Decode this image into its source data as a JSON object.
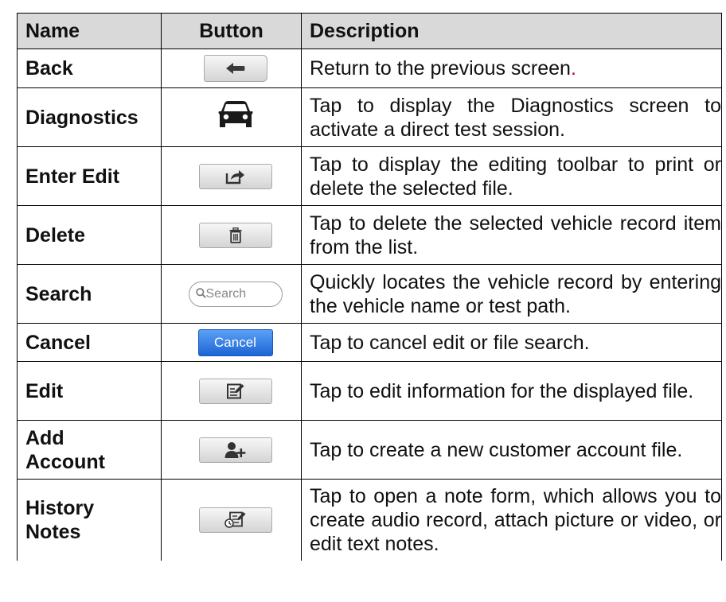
{
  "headers": {
    "name": "Name",
    "button": "Button",
    "description": "Description"
  },
  "rows": [
    {
      "name": "Back",
      "button_icon": "back-arrow-icon",
      "description": "Return to the previous screen",
      "description_end": "."
    },
    {
      "name": "Diagnostics",
      "button_icon": "car-icon",
      "description": "Tap to display the Diagnostics screen to activate a direct test session."
    },
    {
      "name": "Enter Edit",
      "button_icon": "share-arrow-icon",
      "description": "Tap to display the editing toolbar to print or delete the selected file."
    },
    {
      "name": "Delete",
      "button_icon": "trash-icon",
      "description": "Tap to delete the selected vehicle record item from the list."
    },
    {
      "name": "Search",
      "button_icon": "search-icon",
      "button_text": "Search",
      "description": "Quickly locates the vehicle record by entering the vehicle name or test path."
    },
    {
      "name": "Cancel",
      "button_text": "Cancel",
      "description": "Tap to cancel edit or file search."
    },
    {
      "name": "Edit",
      "button_icon": "edit-note-icon",
      "description": "Tap to edit information for the displayed file."
    },
    {
      "name_line1": "Add",
      "name_line2": "Account",
      "button_icon": "add-user-icon",
      "description": "Tap to create a new customer account file."
    },
    {
      "name_line1": "History",
      "name_line2": "Notes",
      "button_icon": "history-notes-icon",
      "description": "Tap to open a note form, which allows you to create audio record, attach picture or video, or edit text notes."
    }
  ],
  "colors": {
    "header_bg": "#d9d9d9",
    "cancel_blue": "#1d64d6",
    "accent_red": "#c0001a"
  }
}
